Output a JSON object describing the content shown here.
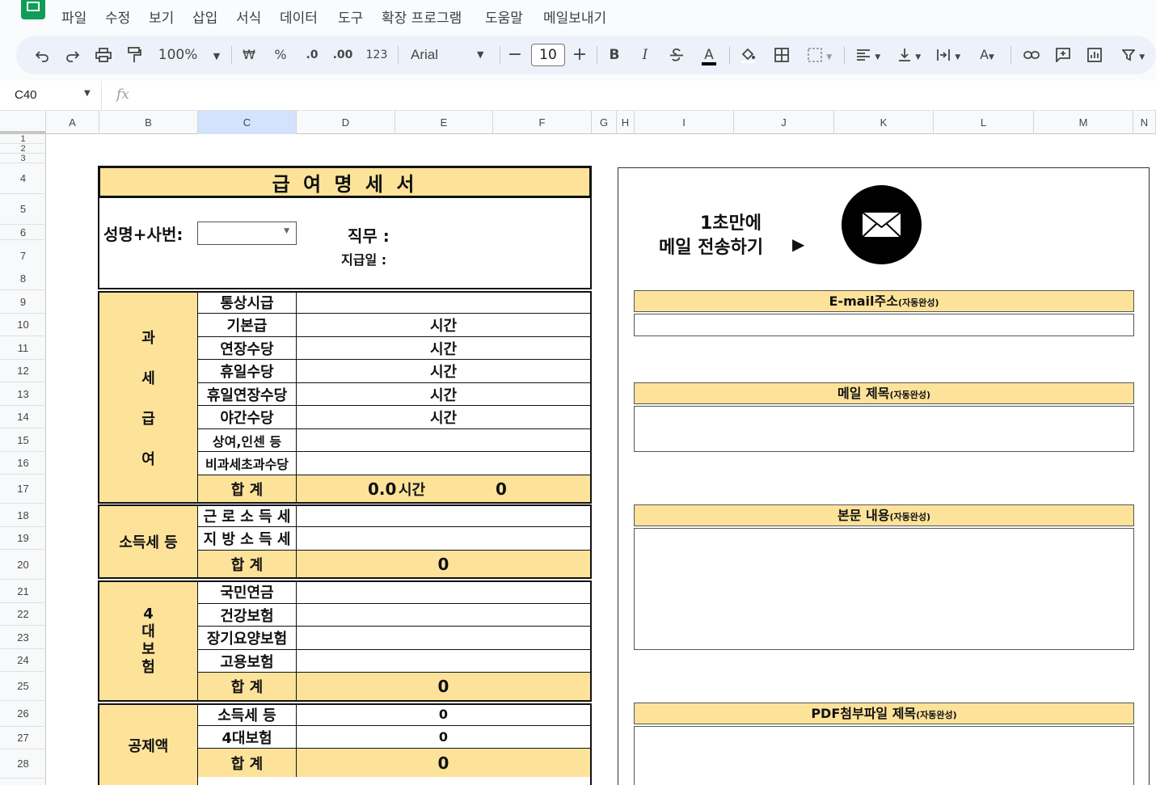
{
  "menu": [
    "파일",
    "수정",
    "보기",
    "삽입",
    "서식",
    "데이터",
    "도구",
    "확장 프로그램",
    "도움말",
    "메일보내기"
  ],
  "toolbar": {
    "zoom": "100%",
    "currency": "₩",
    "percent": "%",
    "dec_minus": ".0",
    "dec_plus": ".00",
    "format_123": "123",
    "font": "Arial",
    "font_size": "10",
    "bold": "B",
    "italic": "I",
    "text_color": "A"
  },
  "formula_bar": {
    "cell_ref": "C40",
    "fx": "fx",
    "value": ""
  },
  "columns": [
    "A",
    "B",
    "C",
    "D",
    "E",
    "F",
    "G",
    "H",
    "I",
    "J",
    "K",
    "L",
    "M",
    "N"
  ],
  "rows": [
    "1",
    "2",
    "3",
    "4",
    "5",
    "6",
    "7",
    "8",
    "9",
    "10",
    "11",
    "12",
    "13",
    "14",
    "15",
    "16",
    "17",
    "18",
    "19",
    "20",
    "21",
    "22",
    "23",
    "24",
    "25",
    "26",
    "27",
    "28"
  ],
  "payslip": {
    "title": "급 여 명 세 서",
    "name_label": "성명+사번:",
    "name_value": "",
    "job_label": "직무 :",
    "paydate_label": "지급일 :",
    "taxable": {
      "label": [
        "과",
        "세",
        "급",
        "여"
      ],
      "items": [
        "통상시급",
        "기본급",
        "연장수당",
        "휴일수당",
        "휴일연장수당",
        "야간수당",
        "상여,인센 등",
        "비과세초과수당"
      ],
      "hours_unit": "시간",
      "total_label": "합 계",
      "total_hours": "0.0",
      "total_amount": "0"
    },
    "income_tax": {
      "label": "소득세 등",
      "items": [
        "근 로 소 득 세",
        "지 방 소 득 세"
      ],
      "total_label": "합 계",
      "total_amount": "0"
    },
    "insurance": {
      "label": [
        "4",
        "대",
        "보",
        "험"
      ],
      "items": [
        "국민연금",
        "건강보험",
        "장기요양보험",
        "고용보험"
      ],
      "total_label": "합 계",
      "total_amount": "0"
    },
    "deduction": {
      "label": "공제액",
      "items": [
        "소득세 등",
        "4대보험"
      ],
      "values": [
        "0",
        "0"
      ],
      "total_label": "합 계",
      "total_amount": "0"
    }
  },
  "mail_panel": {
    "send_line1": "1초만에",
    "send_line2": "메일 전송하기",
    "send_arrow": "▶",
    "email_label": "E-mail주소",
    "subject_label": "메일 제목",
    "body_label": "본문 내용",
    "pdf_label": "PDF첨부파일 제목",
    "auto": "(자동완성)"
  },
  "colors": {
    "accent_yellow": "#fde39a",
    "sheets_green": "#0f9d58",
    "selected_col": "#d3e3fd"
  }
}
